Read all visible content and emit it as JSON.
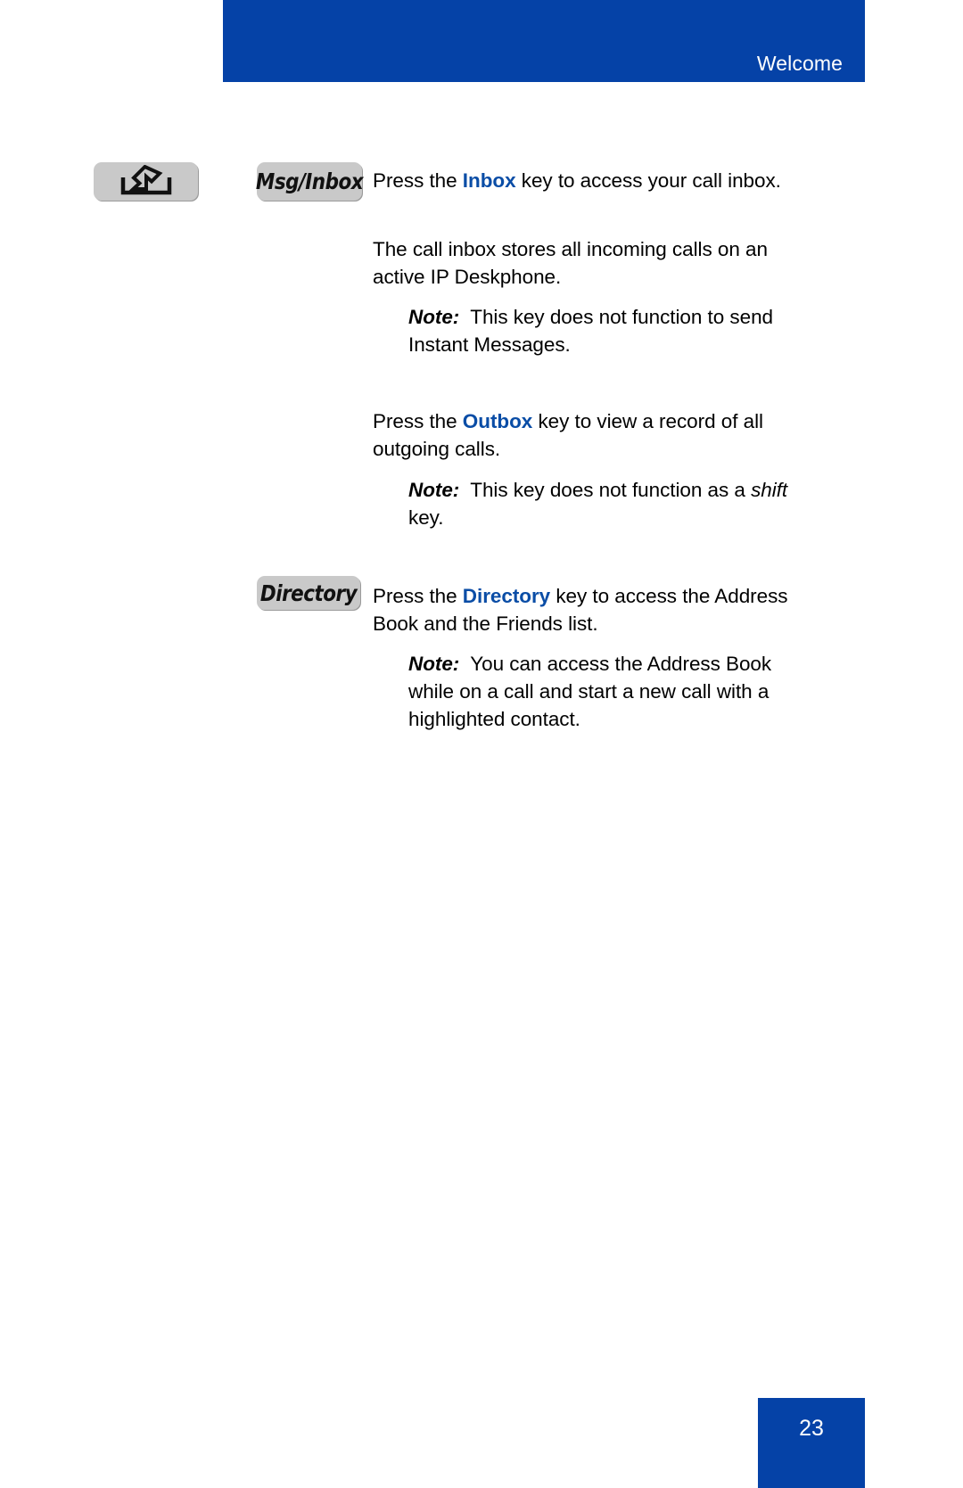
{
  "document": {
    "header": {
      "title": "Welcome",
      "bar_color": "#0542A7"
    },
    "footer": {
      "page_number": "23",
      "block_color": "#0542A7"
    },
    "accent_keyword_color": "#0A4DA6",
    "keycap_color": "#c9c9c9"
  },
  "keycaps": {
    "inbox_icon": {
      "icon_name": "inbox-tray-arrow-icon",
      "label": ""
    },
    "msg_inbox": {
      "label": "Msg/Inbox"
    },
    "directory": {
      "label": "Directory"
    }
  },
  "content": {
    "inbox_paragraph": {
      "lead": "Press the ",
      "keyword": "Inbox",
      "rest": " key to access your call inbox."
    },
    "inbox_description": "The call inbox stores all incoming calls on an active IP Deskphone.",
    "inbox_note": {
      "label": "Note:",
      "text": "This key does not function to send Instant Messages."
    },
    "outbox_paragraph": {
      "lead": "Press the ",
      "keyword": "Outbox",
      "rest": " key to view a record of all outgoing calls."
    },
    "outbox_note": {
      "label": "Note:",
      "text_before": "This key does not function as a ",
      "italic_word": "shift",
      "text_after": " key."
    },
    "directory_paragraph": {
      "lead": "Press the ",
      "keyword": "Directory",
      "rest": " key to access the Address Book and the Friends list."
    },
    "directory_note": {
      "label": "Note:",
      "text": "You can access the Address Book while on a call and start a new call with a highlighted contact."
    }
  }
}
